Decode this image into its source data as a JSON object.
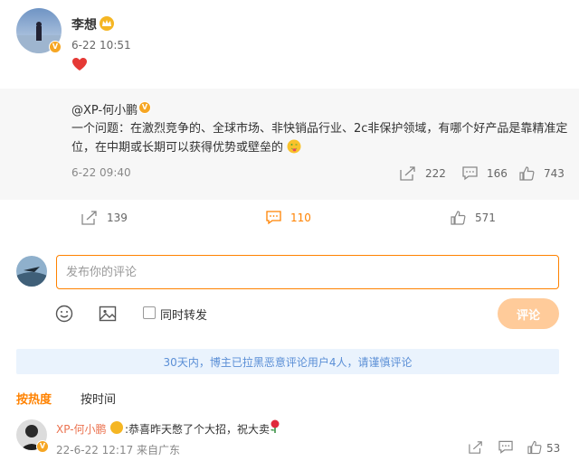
{
  "post": {
    "author": "李想",
    "time": "6-22 10:51",
    "content_emoji": "heart"
  },
  "quote": {
    "author": "@XP-何小鹏",
    "text": "一个问题：在激烈竞争的、全球市场、非快销品行业、2c非保护领域，有哪个好产品是靠精准定位，在中期或长期可以获得优势或壁垒的",
    "time": "6-22 09:40",
    "reposts": "222",
    "comments": "166",
    "likes": "743"
  },
  "actions": {
    "reposts": "139",
    "comments": "110",
    "likes": "571"
  },
  "composer": {
    "placeholder": "发布你的评论",
    "repost_label": "同时转发",
    "submit_label": "评论"
  },
  "notice": "30天内，博主已拉黑恶意评论用户4人，请谨慎评论",
  "sort_tabs": {
    "hot": "按热度",
    "time": "按时间"
  },
  "comment": {
    "author": "XP-何小鹏",
    "text": "恭喜昨天憋了个大招，祝大卖",
    "meta": "22-6-22 12:17 来自广东",
    "likes": "53"
  },
  "colors": {
    "accent": "#ff8200",
    "link": "#eb7350",
    "notice_text": "#5b8fd6"
  }
}
